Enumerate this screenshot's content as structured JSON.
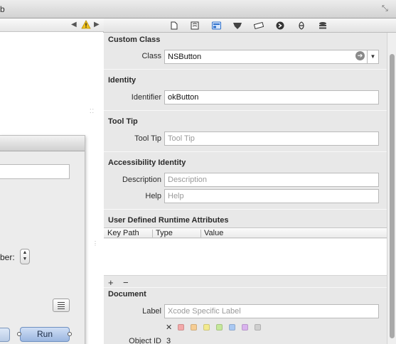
{
  "window": {
    "title_fragment": "b"
  },
  "canvas": {
    "run_button": "Run",
    "number_label_fragment": "ber:"
  },
  "inspector": {
    "custom_class": {
      "title": "Custom Class",
      "class_label": "Class",
      "class_value": "NSButton"
    },
    "identity": {
      "title": "Identity",
      "identifier_label": "Identifier",
      "identifier_value": "okButton"
    },
    "tool_tip": {
      "title": "Tool Tip",
      "label": "Tool Tip",
      "placeholder": "Tool Tip"
    },
    "accessibility": {
      "title": "Accessibility Identity",
      "description_label": "Description",
      "description_placeholder": "Description",
      "help_label": "Help",
      "help_placeholder": "Help"
    },
    "runtime_attributes": {
      "title": "User Defined Runtime Attributes",
      "columns": [
        "Key Path",
        "Type",
        "Value"
      ],
      "add": "+",
      "remove": "−"
    },
    "document": {
      "title": "Document",
      "label_label": "Label",
      "label_placeholder": "Xcode Specific Label",
      "clear_label": "✕",
      "label_colors": [
        "#f3a9a9",
        "#f6cd93",
        "#f3ea8e",
        "#c5e89a",
        "#a9c8f2",
        "#d9b3ee",
        "#cfcfcf"
      ],
      "object_id_label": "Object ID",
      "object_id_value": "3"
    }
  }
}
